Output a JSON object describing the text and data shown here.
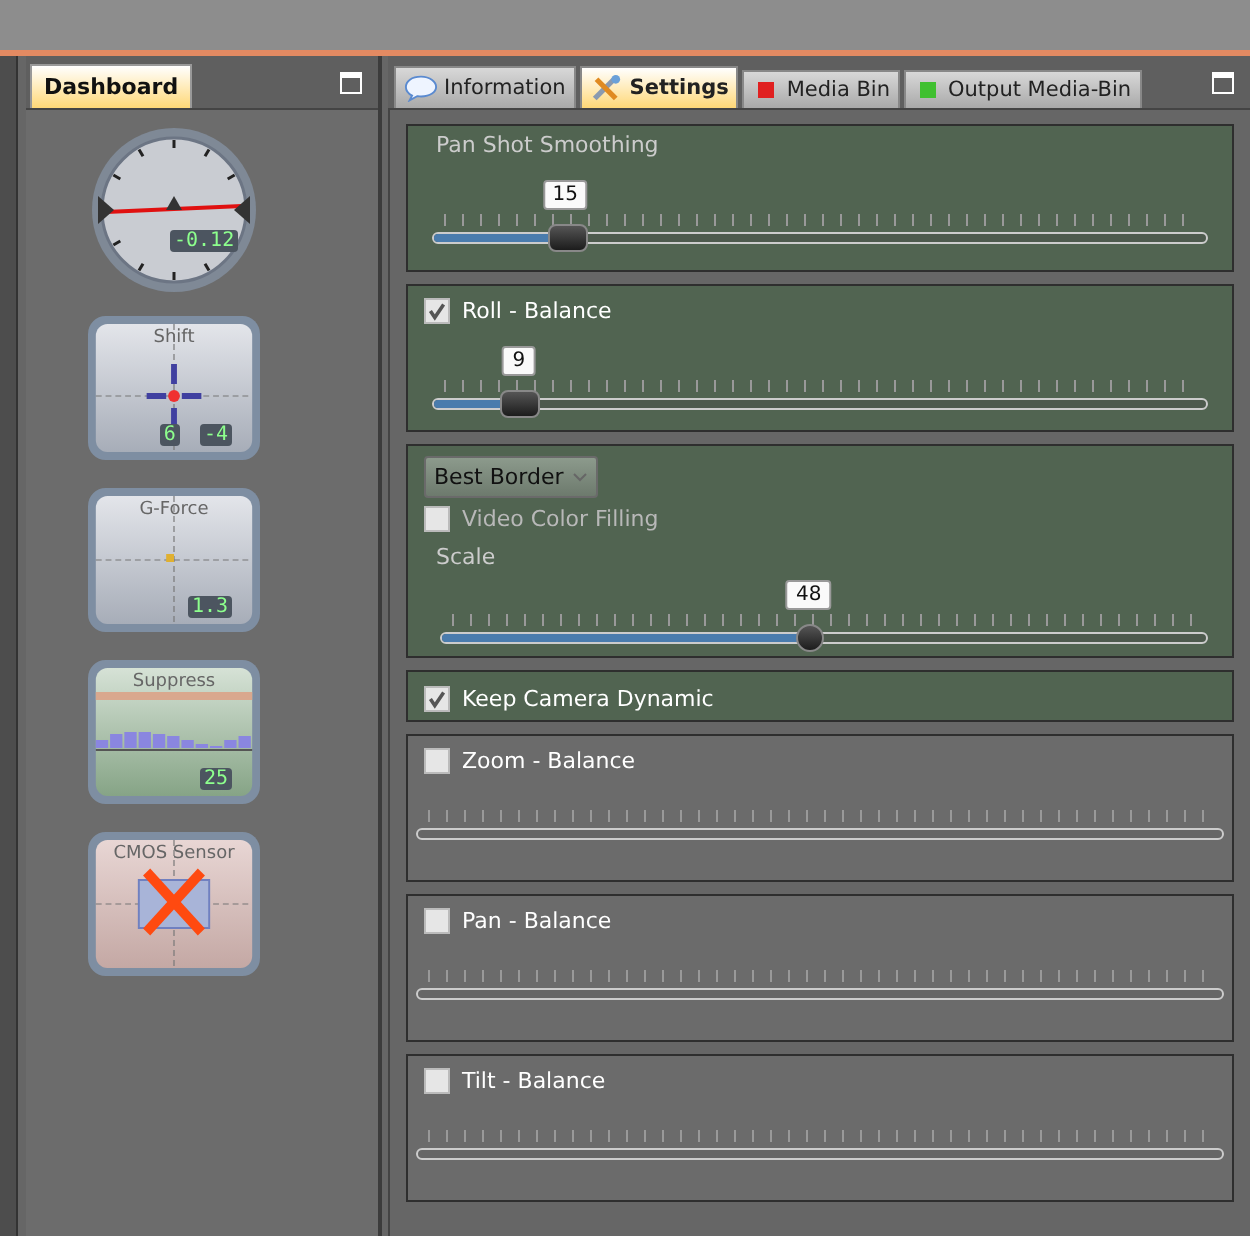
{
  "dashboard": {
    "tab": "Dashboard",
    "widgets": [
      {
        "kind": "dial",
        "readouts": [
          "-0.12"
        ]
      },
      {
        "kind": "crosshair",
        "title": "Shift",
        "readouts": [
          "6",
          "-4"
        ]
      },
      {
        "kind": "gforce",
        "title": "G-Force",
        "readouts": [
          "1.3"
        ]
      },
      {
        "kind": "bars",
        "title": "Suppress",
        "readouts": [
          "25"
        ]
      },
      {
        "kind": "sensor",
        "title": "CMOS Sensor",
        "error": true
      }
    ]
  },
  "tabs": [
    {
      "kind": "bubble",
      "label": "Information",
      "selected": false
    },
    {
      "kind": "tools",
      "label": "Settings",
      "selected": true
    },
    {
      "kind": "dot",
      "label": "Media Bin",
      "color": "#e02020",
      "selected": false
    },
    {
      "kind": "dot",
      "label": "Output Media-Bin",
      "color": "#40c030",
      "selected": false
    }
  ],
  "sections": [
    {
      "kind": "slider",
      "label": "Pan Shot Smoothing",
      "slider": {
        "value": "15",
        "level": 0.17
      }
    },
    {
      "kind": "check_slider",
      "label": "Roll - Balance",
      "checked": true,
      "slider": {
        "value": "9",
        "level": 0.11
      }
    },
    {
      "kind": "options",
      "dropdown": "Best Border",
      "fill": {
        "label": "Video Color Filling",
        "checked": false
      },
      "scale_label": "Scale",
      "slider": {
        "value": "48",
        "level": 0.48,
        "round": true
      }
    },
    {
      "kind": "check",
      "label": "Keep Camera Dynamic",
      "checked": true
    },
    {
      "kind": "check_slider",
      "label": "Zoom - Balance",
      "checked": false
    },
    {
      "kind": "check_slider",
      "label": "Pan - Balance",
      "checked": false
    },
    {
      "kind": "check_slider",
      "label": "Tilt - Balance",
      "checked": false
    }
  ]
}
